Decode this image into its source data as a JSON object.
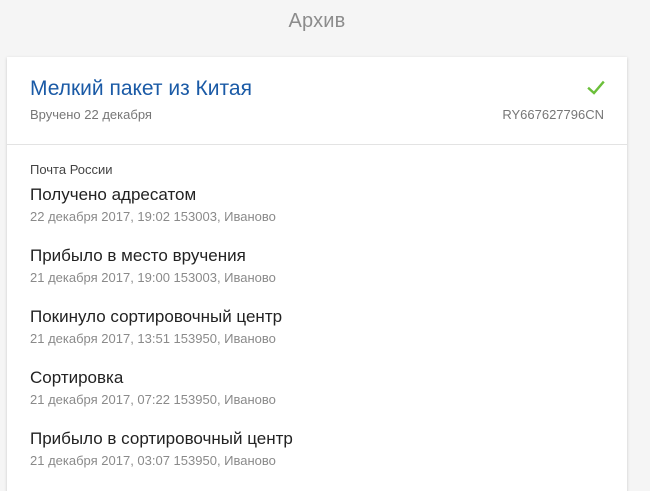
{
  "header": {
    "section_title": "Архив"
  },
  "parcel": {
    "title": "Мелкий пакет из Китая",
    "delivered_text": "Вручено 22 декабря",
    "tracking_number": "RY667627796CN",
    "status_icon": "check-icon",
    "status_color": "#6bbf3a",
    "title_color": "#1a5aa6"
  },
  "carrier": "Почта России",
  "events": [
    {
      "status": "Получено адресатом",
      "details": "22 декабря 2017, 19:02 153003, Иваново"
    },
    {
      "status": "Прибыло в место вручения",
      "details": "21 декабря 2017, 19:00 153003, Иваново"
    },
    {
      "status": "Покинуло сортировочный центр",
      "details": "21 декабря 2017, 13:51 153950, Иваново"
    },
    {
      "status": "Сортировка",
      "details": "21 декабря 2017, 07:22 153950, Иваново"
    },
    {
      "status": "Прибыло в сортировочный центр",
      "details": "21 декабря 2017, 03:07 153950, Иваново"
    }
  ]
}
